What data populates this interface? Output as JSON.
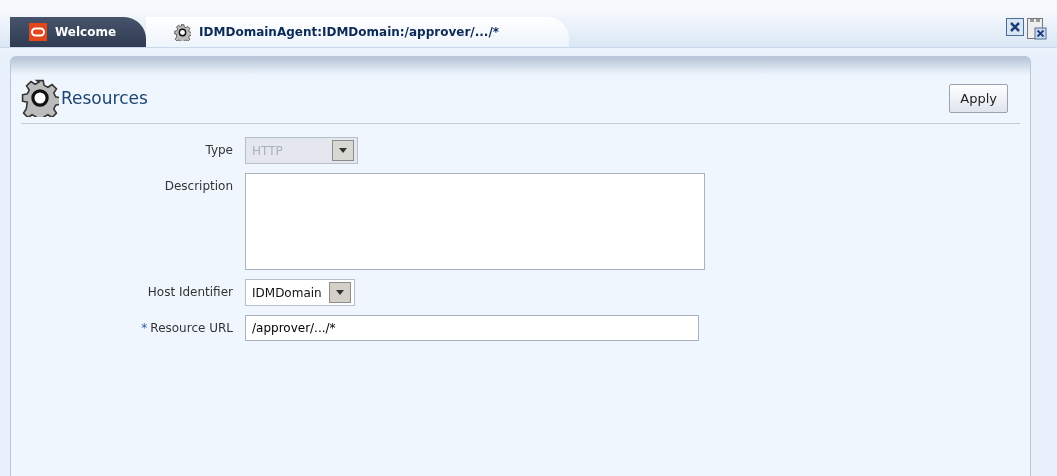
{
  "tabs": [
    {
      "label": "Welcome",
      "kind": "home",
      "selected": false
    },
    {
      "label": "IDMDomainAgent:IDMDomain:/approver/.../*",
      "kind": "resource",
      "selected": true
    }
  ],
  "panel": {
    "title": "Resources",
    "apply_button": "Apply"
  },
  "fields": [
    {
      "kind": "select",
      "label": "Type",
      "value": "HTTP",
      "disabled": true,
      "required": false
    },
    {
      "kind": "textarea",
      "label": "Description",
      "required": false
    },
    {
      "kind": "select",
      "label": "Host Identifier",
      "value": "IDMDomain",
      "disabled": false,
      "required": false
    },
    {
      "kind": "text",
      "label": "Resource URL",
      "value": "/approver/.../*",
      "required": true,
      "required_mark": "*"
    }
  ]
}
